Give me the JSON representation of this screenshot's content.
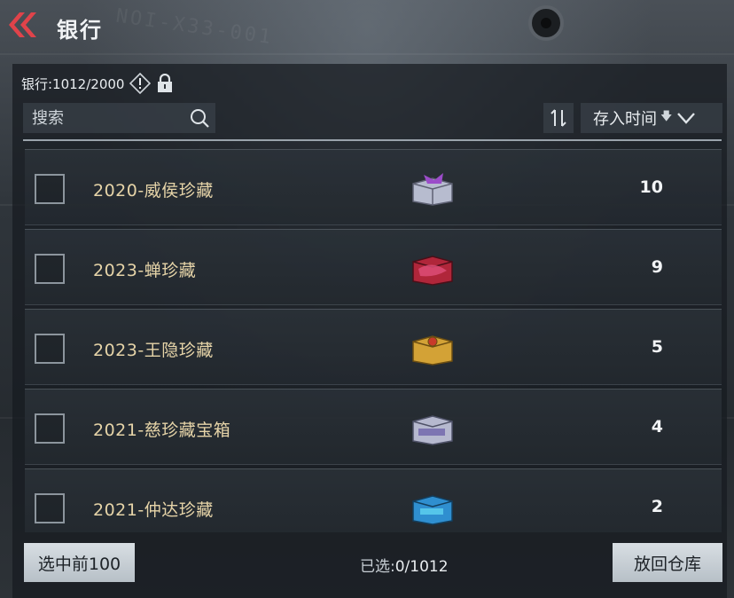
{
  "header": {
    "title": "银行"
  },
  "bank": {
    "label": "银行:1012/2000"
  },
  "search": {
    "placeholder": "搜索"
  },
  "sort": {
    "label": "存入时间"
  },
  "items": [
    {
      "name": "2020-威侯珍藏",
      "count": "10",
      "chest_color": "#b7bccf",
      "accent": "#9b4cc9"
    },
    {
      "name": "2023-蝉珍藏",
      "count": "9",
      "chest_color": "#b0263a",
      "accent": "#e0507a"
    },
    {
      "name": "2023-王隐珍藏",
      "count": "5",
      "chest_color": "#d3a236",
      "accent": "#c83a2a"
    },
    {
      "name": "2021-慈珍藏宝箱",
      "count": "4",
      "chest_color": "#b6b9cf",
      "accent": "#6a5fa8"
    },
    {
      "name": "2021-仲达珍藏",
      "count": "2",
      "chest_color": "#2f8fd0",
      "accent": "#5fd2f0"
    }
  ],
  "footer": {
    "select_top_label": "选中前100",
    "selected_label": "已选:",
    "selected_value": "0/1012",
    "return_label": "放回仓库"
  },
  "colors": {
    "back_arrow": "#e0434a",
    "item_name": "#e6d4a8",
    "button_bg": "#c7ced4"
  },
  "icons": {
    "back": "double-chevron-left-icon",
    "info": "exclamation-diamond-icon",
    "lock": "lock-icon",
    "search": "search-icon",
    "sort_toggle": "sort-arrows-icon",
    "sort_dropdown": "chevron-down-icon"
  }
}
